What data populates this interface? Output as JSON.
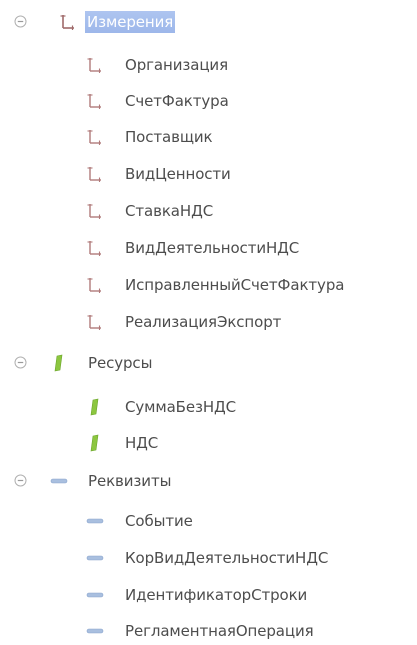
{
  "tree": {
    "dimensions": {
      "label": "Измерения",
      "icon": "dimension-icon",
      "expanded": true,
      "selected": true,
      "items": [
        {
          "label": "Организация",
          "icon": "dimension-icon"
        },
        {
          "label": "СчетФактура",
          "icon": "dimension-icon"
        },
        {
          "label": "Поставщик",
          "icon": "dimension-icon"
        },
        {
          "label": "ВидЦенности",
          "icon": "dimension-icon"
        },
        {
          "label": "СтавкаНДС",
          "icon": "dimension-icon"
        },
        {
          "label": "ВидДеятельностиНДС",
          "icon": "dimension-icon"
        },
        {
          "label": "ИсправленныйСчетФактура",
          "icon": "dimension-icon"
        },
        {
          "label": "РеализацияЭкспорт",
          "icon": "dimension-icon"
        }
      ]
    },
    "resources": {
      "label": "Ресурсы",
      "icon": "resource-icon",
      "expanded": true,
      "items": [
        {
          "label": "СуммаБезНДС",
          "icon": "resource-icon"
        },
        {
          "label": "НДС",
          "icon": "resource-icon"
        }
      ]
    },
    "attributes": {
      "label": "Реквизиты",
      "icon": "attribute-icon",
      "expanded": true,
      "items": [
        {
          "label": "Событие",
          "icon": "attribute-icon"
        },
        {
          "label": "КорВидДеятельностиНДС",
          "icon": "attribute-icon"
        },
        {
          "label": "ИдентификаторСтроки",
          "icon": "attribute-icon"
        },
        {
          "label": "РегламентнаяОперация",
          "icon": "attribute-icon"
        }
      ]
    }
  },
  "colors": {
    "text": "#4d4d4d",
    "selection": "#a8c0ee",
    "dimension_icon": "#c08080",
    "resource_icon": "#8cc63f",
    "attribute_icon": "#9fb6d8",
    "toggle": "#b0b0b0"
  }
}
